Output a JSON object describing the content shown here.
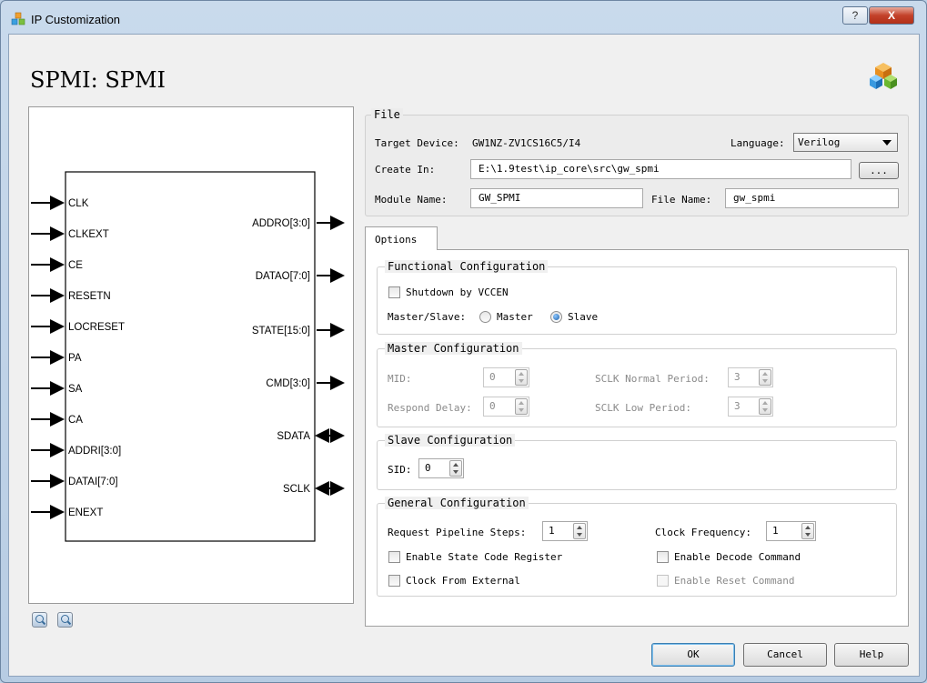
{
  "window": {
    "title": "IP Customization",
    "help_label": "?",
    "close_label": "X"
  },
  "header": {
    "title": "SPMI: SPMI"
  },
  "symbol": {
    "inputs": [
      "CLK",
      "CLKEXT",
      "CE",
      "RESETN",
      "LOCRESET",
      "PA",
      "SA",
      "CA",
      "ADDRI[3:0]",
      "DATAI[7:0]",
      "ENEXT"
    ],
    "outputs": [
      "ADDRO[3:0]",
      "DATAO[7:0]",
      "STATE[15:0]",
      "CMD[3:0]"
    ],
    "bidirs": [
      "SDATA",
      "SCLK"
    ]
  },
  "file": {
    "group_title": "File",
    "target_device_label": "Target Device:",
    "target_device_value": "GW1NZ-ZV1CS16C5/I4",
    "language_label": "Language:",
    "language_value": "Verilog",
    "create_in_label": "Create In:",
    "create_in_value": "E:\\1.9test\\ip_core\\src\\gw_spmi",
    "browse_label": "...",
    "module_name_label": "Module Name:",
    "module_name_value": "GW_SPMI",
    "file_name_label": "File Name:",
    "file_name_value": "gw_spmi"
  },
  "options": {
    "tab_label": "Options",
    "functional": {
      "title": "Functional Configuration",
      "shutdown_label": "Shutdown by VCCEN",
      "shutdown_checked": false,
      "master_slave_label": "Master/Slave:",
      "master_label": "Master",
      "slave_label": "Slave",
      "selected": "Slave"
    },
    "master": {
      "title": "Master Configuration",
      "mid_label": "MID:",
      "mid_value": "0",
      "respond_delay_label": "Respond Delay:",
      "respond_delay_value": "0",
      "sclk_normal_label": "SCLK Normal Period:",
      "sclk_normal_value": "3",
      "sclk_low_label": "SCLK Low Period:",
      "sclk_low_value": "3"
    },
    "slave": {
      "title": "Slave Configuration",
      "sid_label": "SID:",
      "sid_value": "0"
    },
    "general": {
      "title": "General Configuration",
      "pipeline_label": "Request Pipeline Steps:",
      "pipeline_value": "1",
      "clock_freq_label": "Clock Frequency:",
      "clock_freq_value": "1",
      "state_code_label": "Enable State Code Register",
      "decode_cmd_label": "Enable Decode Command",
      "clock_external_label": "Clock From External",
      "reset_cmd_label": "Enable Reset Command"
    }
  },
  "footer": {
    "ok_label": "OK",
    "cancel_label": "Cancel",
    "help_label": "Help"
  }
}
